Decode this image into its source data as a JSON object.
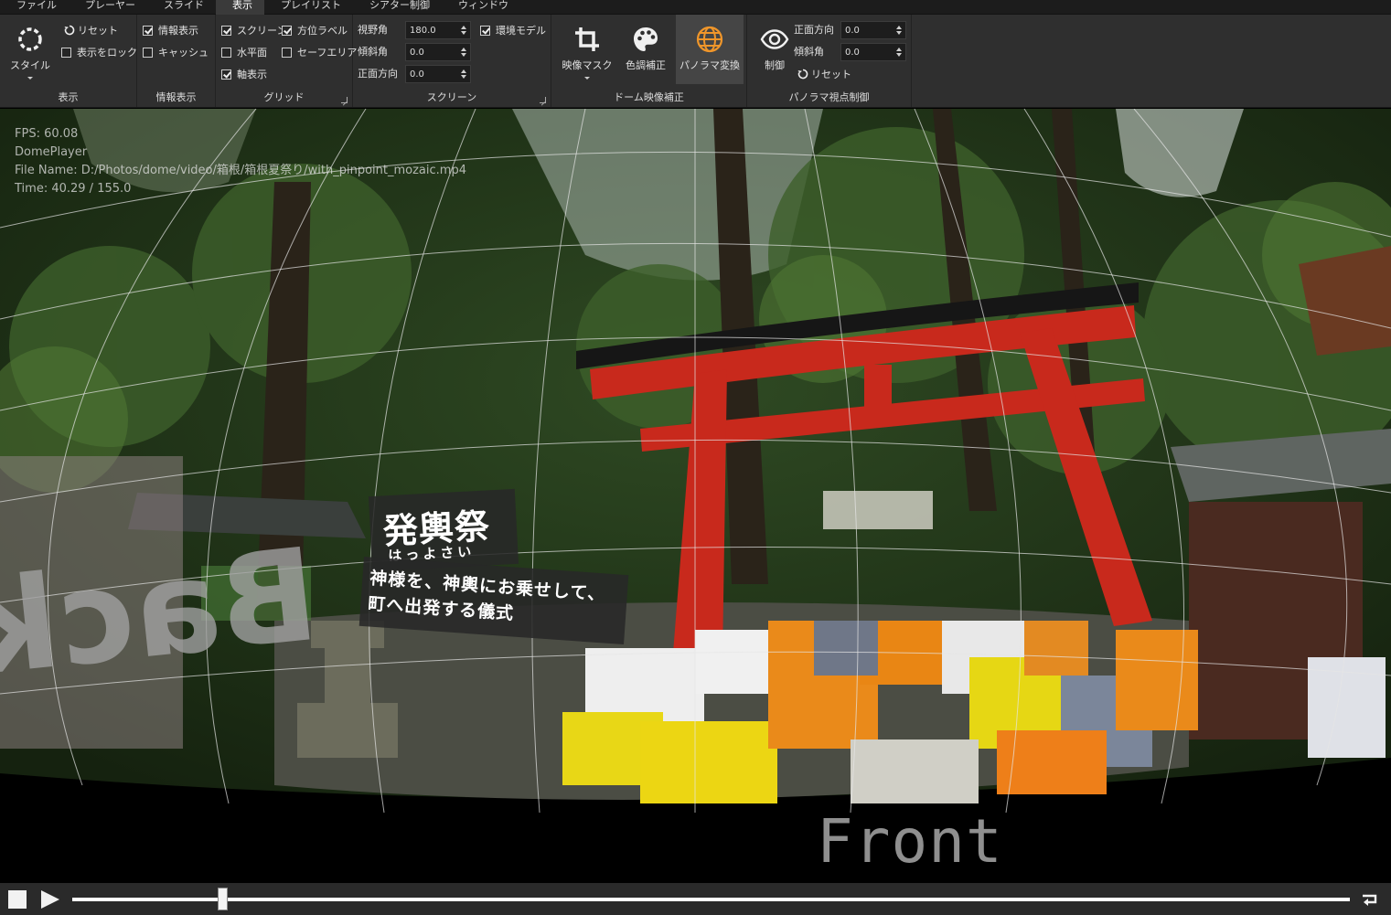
{
  "menu": [
    "ファイル",
    "プレーヤー",
    "スライド",
    "表示",
    "プレイリスト",
    "シアター制御",
    "ウィンドウ"
  ],
  "active_menu": "表示",
  "ribbon": {
    "display": {
      "style_label": "スタイル",
      "reset_label": "リセット",
      "lock_label": "表示をロック",
      "lock_checked": false,
      "group_label": "表示"
    },
    "info": {
      "info_label": "情報表示",
      "info_checked": true,
      "cache_label": "キャッシュ",
      "cache_checked": false,
      "group_label": "情報表示"
    },
    "grid": {
      "screen_label": "スクリーン",
      "screen_checked": true,
      "horizon_label": "水平面",
      "horizon_checked": false,
      "axis_label": "軸表示",
      "axis_checked": true,
      "azimuth_label": "方位ラベル",
      "azimuth_checked": true,
      "safearea_label": "セーフエリア",
      "safearea_checked": false,
      "group_label": "グリッド"
    },
    "screen": {
      "fov_label": "視野角",
      "fov_value": "180.0",
      "tilt_label": "傾斜角",
      "tilt_value": "0.0",
      "front_label": "正面方向",
      "front_value": "0.0",
      "env_label": "環境モデル",
      "env_checked": true,
      "group_label": "スクリーン"
    },
    "dome": {
      "mask_label": "映像マスク",
      "color_label": "色調補正",
      "panorama_label": "パノラマ変換",
      "group_label": "ドーム映像補正"
    },
    "panorama_view": {
      "control_label": "制御",
      "front_label": "正面方向",
      "front_value": "0.0",
      "tilt_label": "傾斜角",
      "tilt_value": "0.0",
      "reset_label": "リセット",
      "group_label": "パノラマ視点制御"
    }
  },
  "overlay": {
    "fps": "FPS: 60.08",
    "app": "DomePlayer",
    "file": "File Name: D:/Photos/dome/video/箱根/箱根夏祭り/with_pinpoint_mozaic.mp4",
    "time": "Time: 40.29 / 155.0"
  },
  "video_text": {
    "title": "発輿祭",
    "reading": "はっよさい",
    "desc_line1": "神様を、神輿にお乗せして、",
    "desc_line2": "町へ出発する儀式"
  },
  "labels": {
    "front": "Front",
    "back": "Back"
  },
  "playback": {
    "progress": 0.118
  },
  "colors": {
    "accent_torii": "#c8291c",
    "ribbon_bg": "#2f2f2f",
    "menubar_bg": "#1c1c1c"
  },
  "icons": [
    "style-icon",
    "reset-icon",
    "crop-icon",
    "palette-icon",
    "globe-icon",
    "eye-icon",
    "stop-icon",
    "play-icon",
    "loop-icon"
  ]
}
